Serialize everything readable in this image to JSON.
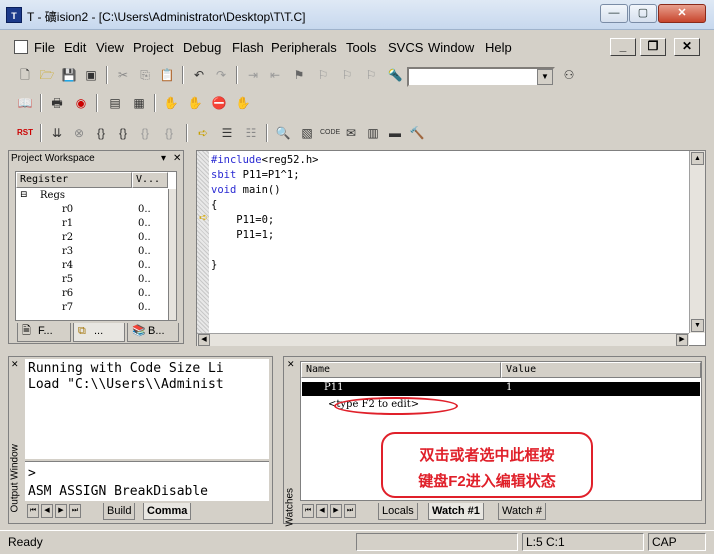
{
  "window": {
    "title": "T  - 礦ision2 - [C:\\Users\\Administrator\\Desktop\\T\\T.C]",
    "icon_text": "T",
    "min_glyph": "—",
    "max_glyph": "▢",
    "close_glyph": "✕"
  },
  "menu": {
    "items": [
      "File",
      "Edit",
      "View",
      "Project",
      "Debug",
      "Flash",
      "Peripherals",
      "Tools",
      "SVCS",
      "Window",
      "Help"
    ],
    "mdi_min": "_",
    "mdi_restore": "❐",
    "mdi_close": "✕"
  },
  "toolbar": {
    "combo_value": "",
    "combo_arrow": "▼",
    "rst_label": "RST"
  },
  "project_workspace": {
    "title": "Project Workspace",
    "pin_glyph": "▾",
    "close_glyph": "✕",
    "columns": [
      "Register",
      "V..."
    ],
    "group": "Regs",
    "registers": [
      {
        "name": "r0",
        "value": "0.."
      },
      {
        "name": "r1",
        "value": "0.."
      },
      {
        "name": "r2",
        "value": "0.."
      },
      {
        "name": "r3",
        "value": "0.."
      },
      {
        "name": "r4",
        "value": "0.."
      },
      {
        "name": "r5",
        "value": "0.."
      },
      {
        "name": "r6",
        "value": "0.."
      },
      {
        "name": "r7",
        "value": "0.."
      }
    ],
    "tabs": [
      "F...",
      "...",
      "B..."
    ]
  },
  "editor": {
    "lines": [
      {
        "kw": "#include",
        "rest": "<reg52.h>"
      },
      {
        "kw": "sbit",
        "rest": " P11=P1^1;"
      },
      {
        "kw": "void",
        "rest": " main()"
      },
      {
        "kw": "",
        "rest": "{"
      },
      {
        "kw": "",
        "rest": "    P11=0;"
      },
      {
        "kw": "",
        "rest": "    P11=1;"
      },
      {
        "kw": "",
        "rest": ""
      },
      {
        "kw": "",
        "rest": ""
      },
      {
        "kw": "",
        "rest": "}"
      }
    ],
    "exec_arrow": "➪"
  },
  "output": {
    "side_label": "Output Window",
    "close_glyph": "✕",
    "lines": [
      "Running with Code Size Li",
      "Load \"C:\\\\Users\\\\Administ"
    ],
    "prompt": ">",
    "command_line": "ASM ASSIGN BreakDisable",
    "tabs": [
      "Build",
      "Comma"
    ]
  },
  "watch": {
    "side_label": "Watches",
    "close_glyph": "✕",
    "columns": [
      "Name",
      "Value"
    ],
    "row_name": "P11",
    "row_value": "1",
    "edit_placeholder": "<type F2 to edit>",
    "tabs": [
      "Locals",
      "Watch #1",
      "Watch #"
    ],
    "annotation_line1": "双击或者选中此框按",
    "annotation_line2": "键盘F2进入编辑状态"
  },
  "status": {
    "left": "Ready",
    "position": "L:5 C:1",
    "caps": "CAP"
  },
  "colors": {
    "annotation": "#e0202a",
    "keyword": "#2b2bd3"
  }
}
